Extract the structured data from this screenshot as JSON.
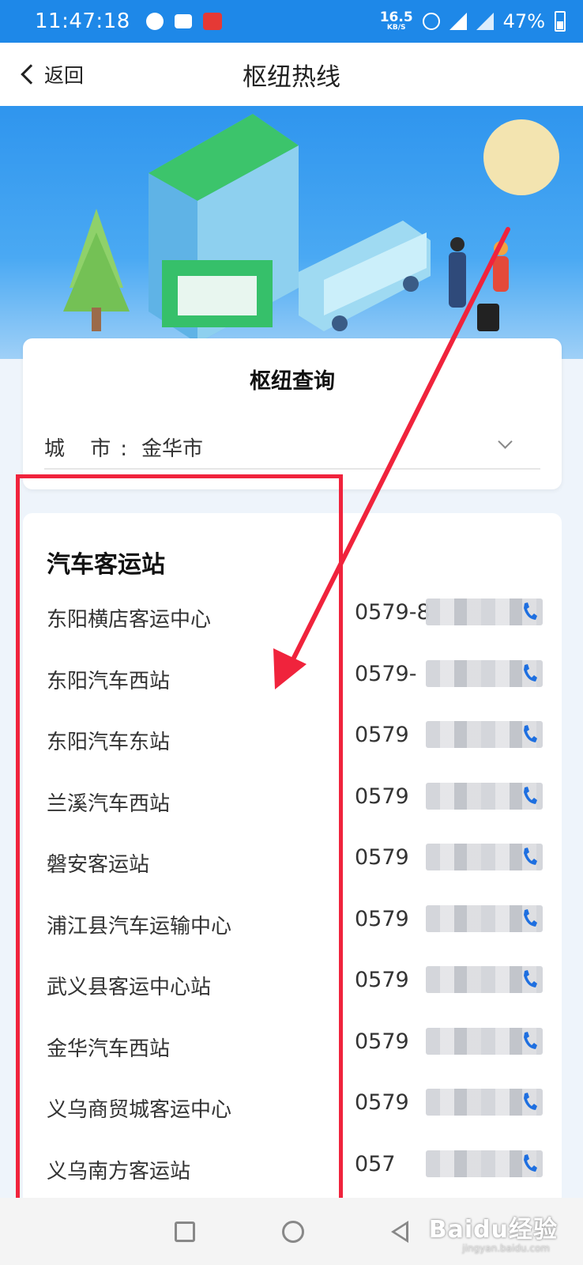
{
  "status_bar": {
    "time": "11:47:18",
    "net_speed_value": "16.5",
    "net_speed_unit": "KB/S",
    "network": "4G",
    "battery": "47%"
  },
  "header": {
    "back_label": "返回",
    "title": "枢纽热线"
  },
  "query": {
    "title": "枢纽查询",
    "city_label": "城 市:",
    "city_value": "金华市"
  },
  "section": {
    "heading": "汽车客运站"
  },
  "stations": [
    {
      "name": "东阳横店客运中心",
      "phone": "0579-8"
    },
    {
      "name": "东阳汽车西站",
      "phone": "0579-"
    },
    {
      "name": "东阳汽车东站",
      "phone": "0579"
    },
    {
      "name": "兰溪汽车西站",
      "phone": "0579"
    },
    {
      "name": "磐安客运站",
      "phone": "0579"
    },
    {
      "name": "浦江县汽车运输中心",
      "phone": "0579"
    },
    {
      "name": "武义县客运中心站",
      "phone": "0579"
    },
    {
      "name": "金华汽车西站",
      "phone": "0579"
    },
    {
      "name": "义乌商贸城客运中心",
      "phone": "0579"
    },
    {
      "name": "义乌南方客运站",
      "phone": "057"
    }
  ],
  "watermark": {
    "brand": "Baidu经验",
    "url": "jingyan.baidu.com"
  },
  "colors": {
    "status_bar": "#1e88e8",
    "annotation_red": "#f0233c",
    "phone_icon_blue": "#1e6fe0"
  }
}
